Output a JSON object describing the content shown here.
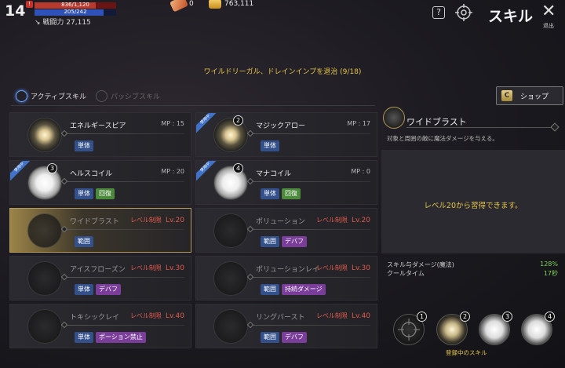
{
  "hud": {
    "level": "14",
    "alert": "!",
    "hp_text": "836/1,120",
    "hp_ratio": 0.746,
    "mp_text": "205/242",
    "mp_ratio": 0.847,
    "power_label": "戦闘力",
    "power_value": "27,115",
    "potion_count": "0",
    "gold": "763,111"
  },
  "header": {
    "title": "スキル",
    "help_icon": "?",
    "close_icon": "✕",
    "close_label": "退出"
  },
  "quest": "ワイルドリーガル、ドレインインプを退治 (9/18)",
  "tabs": {
    "active": "アクティブスキル",
    "passive": "パッシブスキル"
  },
  "shop_label": "ショップ",
  "shop_icon": "C",
  "skills": [
    {
      "name": "エネルギースピア",
      "mp": "MP : 15",
      "tags": [
        {
          "t": "単体",
          "c": "blue"
        }
      ]
    },
    {
      "name": "マジックアロー",
      "mp": "MP : 17",
      "slot": "2",
      "ribbon": "使用中",
      "tags": [
        {
          "t": "単体",
          "c": "blue"
        }
      ]
    },
    {
      "name": "ヘルスコイル",
      "mp": "MP : 20",
      "slot": "3",
      "ribbon": "使用中",
      "tags": [
        {
          "t": "単体",
          "c": "blue"
        },
        {
          "t": "回復",
          "c": "green"
        }
      ]
    },
    {
      "name": "マナコイル",
      "mp": "MP : 0",
      "slot": "4",
      "ribbon": "使用中",
      "tags": [
        {
          "t": "単体",
          "c": "blue"
        },
        {
          "t": "回復",
          "c": "green"
        }
      ]
    },
    {
      "name": "ワイドブラスト",
      "req": "レベル制限",
      "lv": "Lv.20",
      "tags": [
        {
          "t": "範囲",
          "c": "blue"
        }
      ]
    },
    {
      "name": "ポリューション",
      "req": "レベル制限",
      "lv": "Lv.20",
      "tags": [
        {
          "t": "範囲",
          "c": "blue"
        },
        {
          "t": "デバフ",
          "c": "purple"
        }
      ]
    },
    {
      "name": "アイスフローズン",
      "req": "レベル制限",
      "lv": "Lv.30",
      "tags": [
        {
          "t": "単体",
          "c": "blue"
        },
        {
          "t": "デバフ",
          "c": "purple"
        }
      ]
    },
    {
      "name": "ポリューションレイ",
      "req": "レベル制限",
      "lv": "Lv.30",
      "tags": [
        {
          "t": "範囲",
          "c": "blue"
        },
        {
          "t": "持続ダメージ",
          "c": "purple"
        }
      ]
    },
    {
      "name": "トキシックレイ",
      "req": "レベル制限",
      "lv": "Lv.40",
      "tags": [
        {
          "t": "単体",
          "c": "blue"
        },
        {
          "t": "ポーション禁止",
          "c": "purple"
        }
      ]
    },
    {
      "name": "リングバースト",
      "req": "レベル制限",
      "lv": "Lv.40",
      "tags": [
        {
          "t": "範囲",
          "c": "blue"
        },
        {
          "t": "デバフ",
          "c": "purple"
        }
      ]
    }
  ],
  "detail": {
    "name": "ワイドブラスト",
    "description": "対象と周囲の敵に魔法ダメージを与える。",
    "learn_text": "レベル20から習得できます。",
    "stats": [
      {
        "label": "スキル与ダメージ(魔法)",
        "value": "128%"
      },
      {
        "label": "クールタイム",
        "value": "17秒"
      }
    ]
  },
  "quickslots": {
    "slots": [
      "1",
      "2",
      "3",
      "4"
    ],
    "label": "登録中のスキル"
  }
}
